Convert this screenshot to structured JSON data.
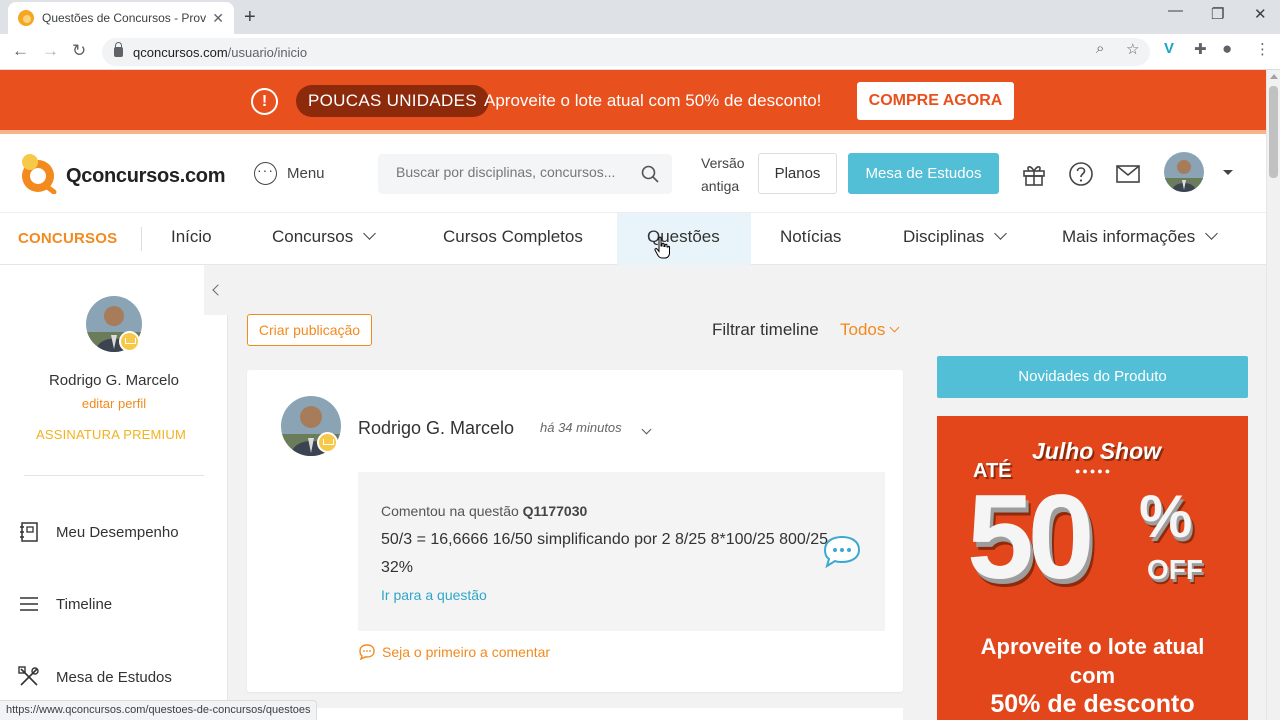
{
  "browser": {
    "tab_title": "Questões de Concursos - Provas,",
    "tab_close": "✕",
    "new_tab": "+",
    "url_host": "qconcursos.com",
    "url_path": "/usuario/inicio",
    "status_url": "https://www.qconcursos.com/questoes-de-concursos/questoes"
  },
  "promo": {
    "badge": "POUCAS UNIDADES",
    "message": "Aproveite o lote atual com 50% de desconto!",
    "cta": "COMPRE AGORA",
    "alert_glyph": "!"
  },
  "header": {
    "logo_text": "Qconcursos.com",
    "menu_label": "Menu",
    "search_placeholder": "Buscar por disciplinas, concursos...",
    "old_version_line1": "Versão",
    "old_version_line2": "antiga",
    "plans_button": "Planos",
    "desk_button": "Mesa de Estudos",
    "icons": [
      "gift-icon",
      "help-icon",
      "mail-icon"
    ]
  },
  "nav": {
    "brand": "CONCURSOS",
    "items": [
      {
        "label": "Início"
      },
      {
        "label": "Concursos"
      },
      {
        "label": "Cursos Completos"
      },
      {
        "label": "Questões"
      },
      {
        "label": "Notícias"
      },
      {
        "label": "Disciplinas"
      },
      {
        "label": "Mais informações"
      }
    ],
    "active": "Questões"
  },
  "sidebar": {
    "user_name": "Rodrigo G. Marcelo",
    "edit_profile": "editar perfil",
    "subscription": "ASSINATURA PREMIUM",
    "items": [
      {
        "label": "Meu Desempenho",
        "icon": "performance-icon"
      },
      {
        "label": "Timeline",
        "icon": "timeline-icon"
      },
      {
        "label": "Mesa de Estudos",
        "icon": "tools-icon"
      }
    ]
  },
  "timeline": {
    "create_post": "Criar publicação",
    "filter_label": "Filtrar timeline",
    "filter_value": "Todos",
    "post": {
      "author": "Rodrigo G. Marcelo",
      "time": "há 34 minutos",
      "comment_prefix": "Comentou na questão",
      "question_id": "Q1177030",
      "text": "50/3 = 16,6666 16/50 simplificando por 2 8/25 8*100/25 800/25 32%",
      "go_link": "Ir para a questão",
      "first_comment": "Seja o primeiro a comentar"
    }
  },
  "right": {
    "news_button": "Novidades do Produto",
    "ad": {
      "title": "Julho Show",
      "dots": "●●●●●",
      "ate": "ATÉ",
      "number": "50",
      "percent": "%",
      "off": "OFF",
      "line1": "Aproveite o lote atual",
      "line2": "com",
      "line3": "50% de desconto"
    }
  },
  "colors": {
    "brand_orange": "#f28a1e",
    "promo_red": "#e8501e",
    "accent_blue": "#52bfd6",
    "link_blue": "#2fa6c8"
  }
}
